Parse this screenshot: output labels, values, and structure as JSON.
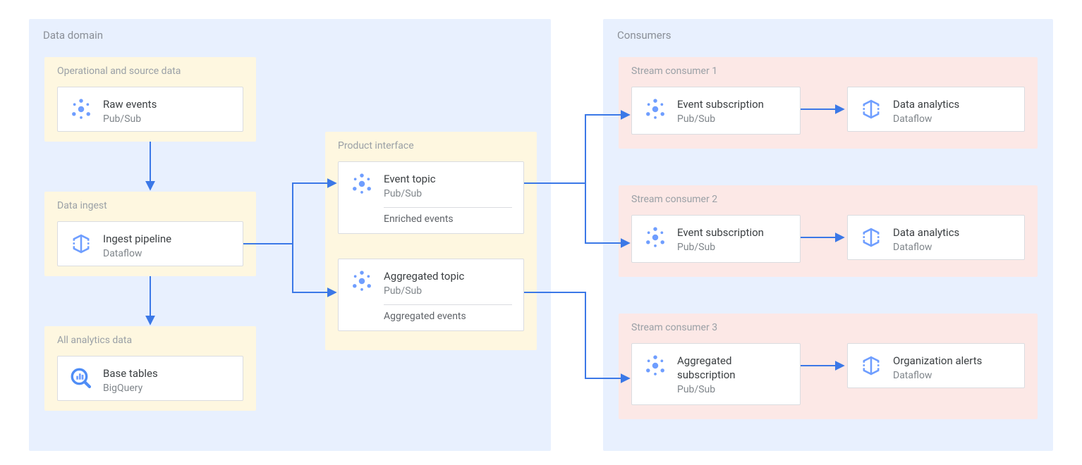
{
  "regions": {
    "data_domain": {
      "title": "Data domain"
    },
    "consumers": {
      "title": "Consumers"
    }
  },
  "groups": {
    "source": {
      "title": "Operational and source data"
    },
    "ingest": {
      "title": "Data ingest"
    },
    "analytics": {
      "title": "All analytics data"
    },
    "product_interface": {
      "title": "Product interface"
    },
    "consumer1": {
      "title": "Stream consumer 1"
    },
    "consumer2": {
      "title": "Stream consumer 2"
    },
    "consumer3": {
      "title": "Stream consumer 3"
    }
  },
  "nodes": {
    "raw_events": {
      "title": "Raw events",
      "sub": "Pub/Sub"
    },
    "ingest_pipeline": {
      "title": "Ingest pipeline",
      "sub": "Dataflow"
    },
    "base_tables": {
      "title": "Base tables",
      "sub": "BigQuery"
    },
    "event_topic": {
      "title": "Event topic",
      "sub": "Pub/Sub",
      "extra": "Enriched events"
    },
    "aggregated_topic": {
      "title": "Aggregated topic",
      "sub": "Pub/Sub",
      "extra": "Aggregated events"
    },
    "c1_sub": {
      "title": "Event subscription",
      "sub": "Pub/Sub"
    },
    "c1_analytics": {
      "title": "Data analytics",
      "sub": "Dataflow"
    },
    "c2_sub": {
      "title": "Event subscription",
      "sub": "Pub/Sub"
    },
    "c2_analytics": {
      "title": "Data analytics",
      "sub": "Dataflow"
    },
    "c3_sub": {
      "title": "Aggregated subscription",
      "sub": "Pub/Sub"
    },
    "c3_alerts": {
      "title": "Organization alerts",
      "sub": "Dataflow"
    }
  }
}
